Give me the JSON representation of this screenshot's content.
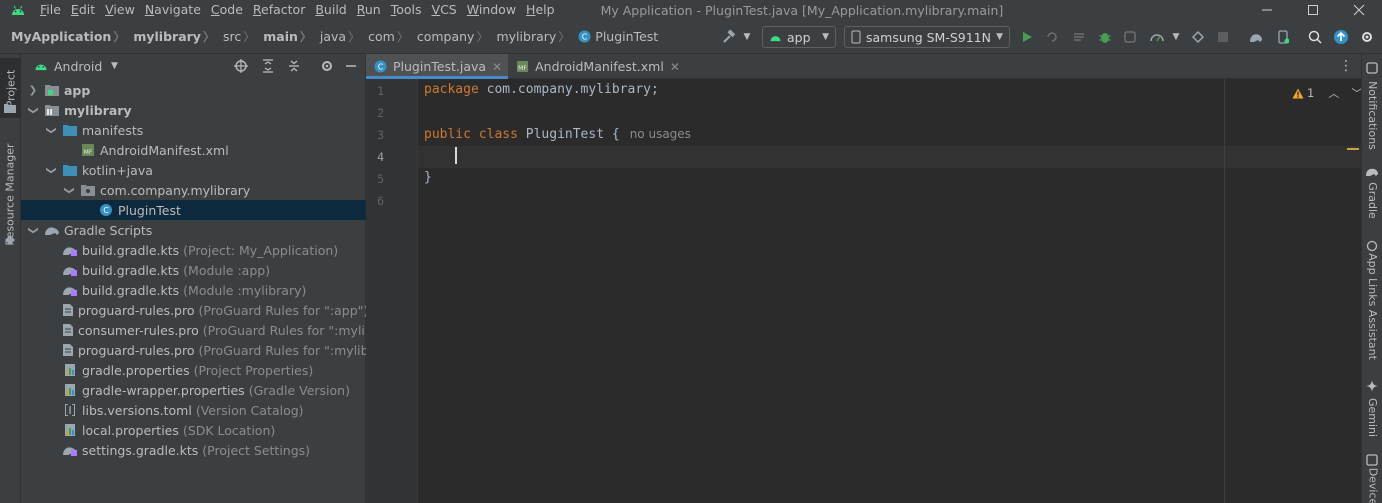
{
  "window": {
    "title": "My Application - PluginTest.java [My_Application.mylibrary.main]",
    "minimize_icon": "minimize-icon",
    "maximize_icon": "maximize-icon",
    "close_icon": "close-icon"
  },
  "menu": [
    "File",
    "Edit",
    "View",
    "Navigate",
    "Code",
    "Refactor",
    "Build",
    "Run",
    "Tools",
    "VCS",
    "Window",
    "Help"
  ],
  "breadcrumb": [
    "MyApplication",
    "mylibrary",
    "src",
    "main",
    "java",
    "com",
    "company",
    "mylibrary",
    "PluginTest"
  ],
  "toolbar": {
    "run_config": "app",
    "device": "samsung SM-S911N"
  },
  "left_strip": {
    "project_tab": "Project",
    "resource_manager_tab": "Resource Manager"
  },
  "project_panel": {
    "view_mode": "Android",
    "tree": [
      {
        "label": "app",
        "hint": "",
        "bold": true
      },
      {
        "label": "mylibrary",
        "hint": "",
        "bold": true
      },
      {
        "label": "manifests",
        "hint": ""
      },
      {
        "label": "AndroidManifest.xml",
        "hint": ""
      },
      {
        "label": "kotlin+java",
        "hint": ""
      },
      {
        "label": "com.company.mylibrary",
        "hint": ""
      },
      {
        "label": "PluginTest",
        "hint": ""
      },
      {
        "label": "Gradle Scripts",
        "hint": ""
      },
      {
        "label": "build.gradle.kts",
        "hint": "(Project: My_Application)"
      },
      {
        "label": "build.gradle.kts",
        "hint": "(Module :app)"
      },
      {
        "label": "build.gradle.kts",
        "hint": "(Module :mylibrary)"
      },
      {
        "label": "proguard-rules.pro",
        "hint": "(ProGuard Rules for \":app\")"
      },
      {
        "label": "consumer-rules.pro",
        "hint": "(ProGuard Rules for \":mylibrary\")"
      },
      {
        "label": "proguard-rules.pro",
        "hint": "(ProGuard Rules for \":mylibrary\")"
      },
      {
        "label": "gradle.properties",
        "hint": "(Project Properties)"
      },
      {
        "label": "gradle-wrapper.properties",
        "hint": "(Gradle Version)"
      },
      {
        "label": "libs.versions.toml",
        "hint": "(Version Catalog)"
      },
      {
        "label": "local.properties",
        "hint": "(SDK Location)"
      },
      {
        "label": "settings.gradle.kts",
        "hint": "(Project Settings)"
      }
    ]
  },
  "editor": {
    "tabs": [
      {
        "label": "PluginTest.java",
        "active": true
      },
      {
        "label": "AndroidManifest.xml",
        "active": false
      }
    ],
    "lines": [
      "1",
      "2",
      "3",
      "4",
      "5",
      "6"
    ],
    "code": {
      "kw_package": "package",
      "package_name": " com.company.mylibrary;",
      "kw_public": "public",
      "kw_class": "class",
      "class_name": "PluginTest",
      "brace_open": "{",
      "usage_hint": "no usages",
      "brace_close": "}"
    },
    "warning_count": "1"
  },
  "right_strip": {
    "notifications": "Notifications",
    "gradle": "Gradle",
    "app_links": "App Links Assistant",
    "gemini": "Gemini",
    "device": "Device"
  },
  "colors": {
    "accent": "#4a88c7",
    "keyword": "#cc7832",
    "run_green": "#499c54",
    "warning": "#f0a732",
    "android_green": "#3ddc84"
  }
}
